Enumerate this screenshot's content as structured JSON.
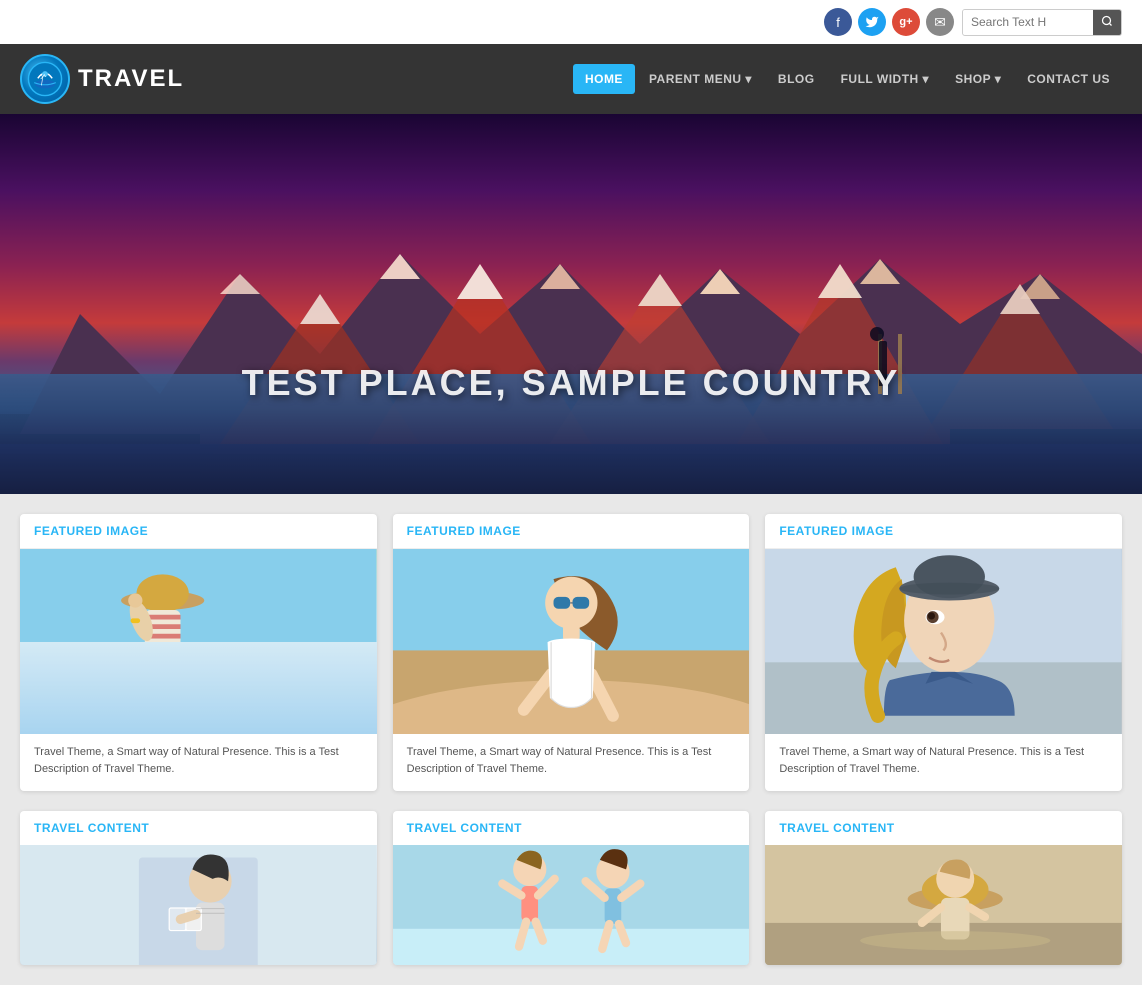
{
  "site": {
    "title": "TRAVEL",
    "logo_icon": "✈"
  },
  "topbar": {
    "search_placeholder": "Search Text H",
    "social": [
      {
        "name": "facebook",
        "icon": "f"
      },
      {
        "name": "twitter",
        "icon": "t"
      },
      {
        "name": "google",
        "icon": "g+"
      },
      {
        "name": "email",
        "icon": "✉"
      }
    ]
  },
  "nav": {
    "items": [
      {
        "label": "HOME",
        "active": true
      },
      {
        "label": "PARENT MENU",
        "has_arrow": true
      },
      {
        "label": "BLOG"
      },
      {
        "label": "FULL WIDTH",
        "has_arrow": true
      },
      {
        "label": "SHOP",
        "has_arrow": true
      },
      {
        "label": "CONTACT US"
      }
    ]
  },
  "hero": {
    "title": "TEST PLACE, SAMPLE COUNTRY"
  },
  "featured_cards": [
    {
      "header_text": "FEATURED ",
      "header_accent": "IMAGE",
      "description": "Travel Theme, a Smart way of Natural Presence. This is a Test Description of Travel Theme.",
      "img_type": "beach"
    },
    {
      "header_text": "FEATURED ",
      "header_accent": "IMAGE",
      "description": "Travel Theme, a Smart way of Natural Presence. This is a Test Description of Travel Theme.",
      "img_type": "desert"
    },
    {
      "header_text": "FEATURED ",
      "header_accent": "IMAGE",
      "description": "Travel Theme, a Smart way of Natural Presence. This is a Test Description of Travel Theme.",
      "img_type": "portrait"
    }
  ],
  "content_cards": [
    {
      "header_text": "TRAVEL ",
      "header_accent": "CONTENT",
      "img_type": "content1"
    },
    {
      "header_text": "TRAVEL ",
      "header_accent": "CONTENT",
      "img_type": "content2"
    },
    {
      "header_text": "TRAVEL ",
      "header_accent": "CONTENT",
      "img_type": "content3"
    }
  ]
}
